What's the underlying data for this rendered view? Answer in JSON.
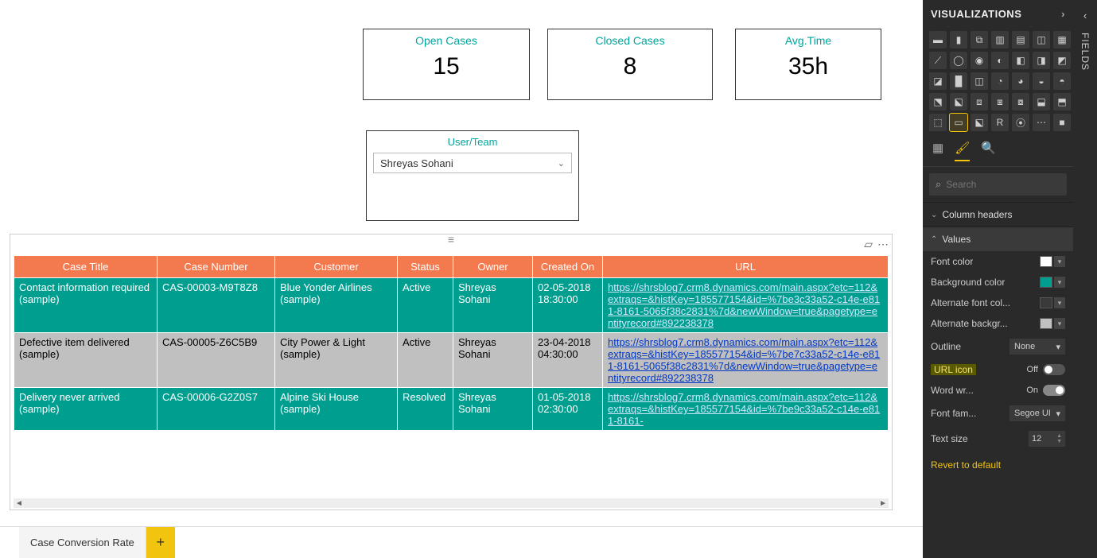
{
  "cards": {
    "open": {
      "title": "Open Cases",
      "value": "15"
    },
    "closed": {
      "title": "Closed Cases",
      "value": "8"
    },
    "avg": {
      "title": "Avg.Time",
      "value": "35h"
    }
  },
  "slicer": {
    "title": "User/Team",
    "value": "Shreyas Sohani"
  },
  "table": {
    "headers": [
      "Case Title",
      "Case Number",
      "Customer",
      "Status",
      "Owner",
      "Created On",
      "URL"
    ],
    "rows": [
      {
        "title": "Contact information required (sample)",
        "number": "CAS-00003-M9T8Z8",
        "customer": "Blue Yonder Airlines (sample)",
        "status": "Active",
        "owner": "Shreyas Sohani",
        "created": "02-05-2018 18:30:00",
        "url": "https://shrsblog7.crm8.dynamics.com/main.aspx?etc=112&extraqs=&histKey=185577154&id=%7be3c33a52-c14e-e811-8161-5065f38c2831%7d&newWindow=true&pagetype=entityrecord#892238378",
        "rowclass": "r-teal"
      },
      {
        "title": "Defective item delivered (sample)",
        "number": "CAS-00005-Z6C5B9",
        "customer": "City Power & Light (sample)",
        "status": "Active",
        "owner": "Shreyas Sohani",
        "created": "23-04-2018 04:30:00",
        "url": "https://shrsblog7.crm8.dynamics.com/main.aspx?etc=112&extraqs=&histKey=185577154&id=%7be7c33a52-c14e-e811-8161-5065f38c2831%7d&newWindow=true&pagetype=entityrecord#892238378",
        "rowclass": "r-gray"
      },
      {
        "title": "Delivery never arrived (sample)",
        "number": "CAS-00006-G2Z0S7",
        "customer": "Alpine Ski House (sample)",
        "status": "Resolved",
        "owner": "Shreyas Sohani",
        "created": "01-05-2018 02:30:00",
        "url": "https://shrsblog7.crm8.dynamics.com/main.aspx?etc=112&extraqs=&histKey=185577154&id=%7be9c33a52-c14e-e811-8161-",
        "rowclass": "r-teal"
      }
    ]
  },
  "tabs": {
    "pages": [
      "Case Conversion Rate"
    ]
  },
  "viz": {
    "title": "VISUALIZATIONS",
    "search_placeholder": "Search",
    "sections": {
      "colheaders": "Column headers",
      "values": "Values"
    },
    "props": {
      "fontcolor": {
        "label": "Font color",
        "swatch": "#ffffff"
      },
      "bgcolor": {
        "label": "Background color",
        "swatch": "#009e8f"
      },
      "altfont": {
        "label": "Alternate font col...",
        "swatch": "#3a3a3a"
      },
      "altbg": {
        "label": "Alternate backgr...",
        "swatch": "#c0c0c0"
      },
      "outline": {
        "label": "Outline",
        "value": "None"
      },
      "urlicon": {
        "label": "URL icon",
        "state": "Off"
      },
      "wordwrap": {
        "label": "Word wr...",
        "state": "On"
      },
      "fontfam": {
        "label": "Font fam...",
        "value": "Segoe UI"
      },
      "textsize": {
        "label": "Text size",
        "value": "12"
      }
    },
    "revert": "Revert to default"
  },
  "fields": {
    "label": "FIELDS"
  }
}
